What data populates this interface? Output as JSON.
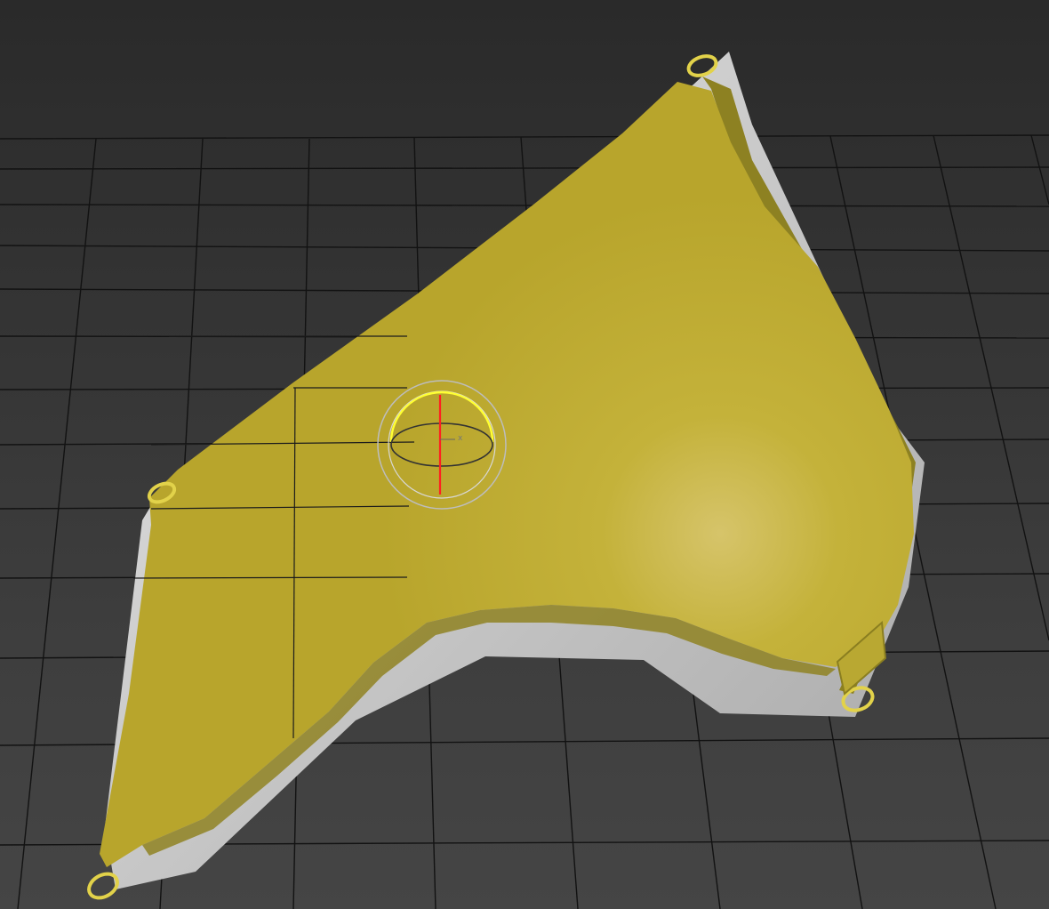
{
  "viewport": {
    "background_top": "#2a2a2a",
    "background_bottom": "#454545",
    "grid_color": "#111111"
  },
  "model": {
    "surface_color": "#c9b73a",
    "surface_shadow_color": "#8c7f1e",
    "backing_color": "#d4d4d4",
    "grommet_color": "#e0d040"
  },
  "gizmo": {
    "type": "rotate",
    "x_axis_label": "x",
    "outer_ring_color": "#bdbdbd",
    "screen_ring_color": "#ffff33",
    "z_axis_color": "#ff2020"
  }
}
